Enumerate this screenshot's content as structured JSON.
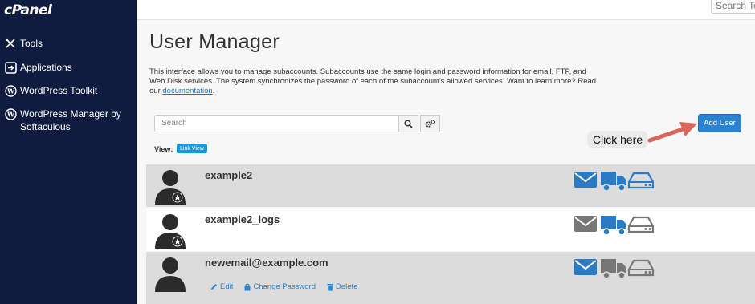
{
  "sidebar": {
    "logo": "cPanel",
    "items": [
      {
        "label": "Tools",
        "icon": "tools-icon"
      },
      {
        "label": "Applications",
        "icon": "applications-icon"
      },
      {
        "label": "WordPress Toolkit",
        "icon": "wordpress-icon"
      },
      {
        "label": "WordPress Manager by Softaculous",
        "icon": "wordpress-icon"
      }
    ]
  },
  "topbar": {
    "search_placeholder": "Search Too"
  },
  "page": {
    "title": "User Manager",
    "description": "This interface allows you to manage subaccounts. Subaccounts use the same login and password information for email, FTP, and Web Disk services. The system synchronizes the password of each of the subaccount's allowed services. Want to learn more? Read our",
    "doc_link": "documentation",
    "doc_suffix": "."
  },
  "toolbar": {
    "search_placeholder": "Search",
    "add_user_label": "Add User",
    "view_label": "View:",
    "view_mode": "Link View"
  },
  "annotation": {
    "callout": "Click here",
    "arrow_color": "#d9685a"
  },
  "colors": {
    "active_service": "#2b7bc4",
    "inactive_service": "#777777",
    "sidebar_bg": "#0f1c3f"
  },
  "users": [
    {
      "name": "example2",
      "services": {
        "email": true,
        "ftp": true,
        "webdisk": true
      }
    },
    {
      "name": "example2_logs",
      "services": {
        "email": false,
        "ftp": true,
        "webdisk": false
      }
    },
    {
      "name": "newemail@example.com",
      "services": {
        "email": true,
        "ftp": false,
        "webdisk": false
      }
    }
  ],
  "row_actions": {
    "edit": "Edit",
    "change_password": "Change Password",
    "delete": "Delete"
  }
}
